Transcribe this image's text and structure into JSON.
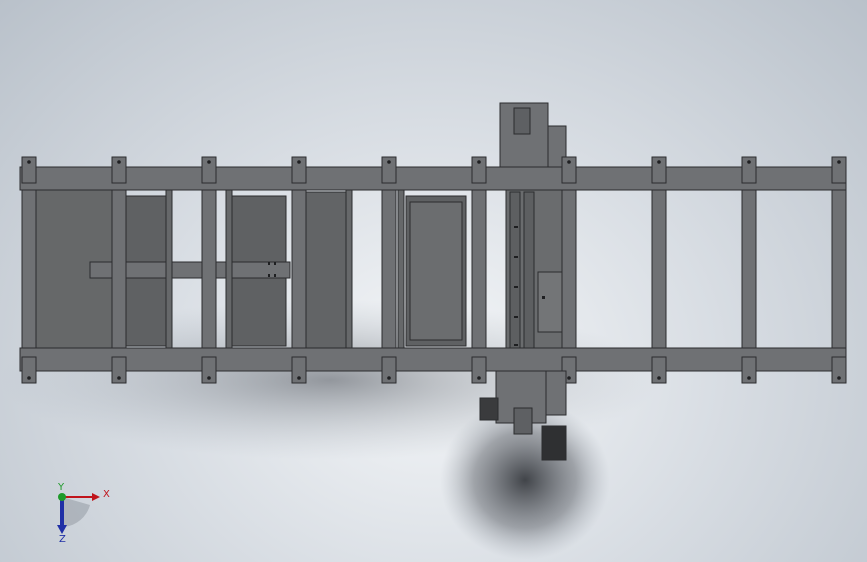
{
  "viewport": {
    "background_top": "#b9c1ca",
    "background_center": "#f4f6f8"
  },
  "model": {
    "frame_color": "#6f7174",
    "frame_edge_color": "#2b2c2e",
    "floor_shadow_color": "#3a3d42"
  },
  "triad": {
    "x_label": "X",
    "y_label": "Y",
    "z_label": "Z",
    "x_color": "#c0141b",
    "y_color": "#1e9a2a",
    "z_color": "#1f2fa6"
  }
}
